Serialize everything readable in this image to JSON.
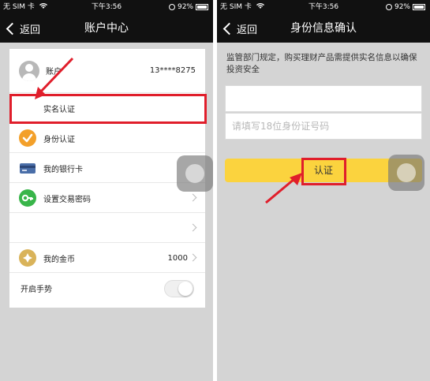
{
  "colors": {
    "accent_yellow": "#fbd33e",
    "highlight_red": "#e01e2b",
    "bar_dark": "#111111",
    "bg_gray": "#d4d4d4",
    "orange_icon": "#f3a02a",
    "green_icon": "#39b54a"
  },
  "left": {
    "status": {
      "carrier": "无 SIM 卡",
      "time": "下午3:56",
      "battery": "92%"
    },
    "nav": {
      "back_label": "返回",
      "title": "账户中心"
    },
    "account": {
      "label": "账户",
      "phone": "13****8275"
    },
    "items": [
      {
        "label": "实名认证",
        "icon": "id-card-icon"
      },
      {
        "label": "身份认证",
        "icon": "check-circle-icon"
      },
      {
        "label": "我的银行卡",
        "icon": "bank-card-icon"
      },
      {
        "label": "设置交易密码",
        "icon": "key-icon"
      },
      {
        "label": "",
        "icon": ""
      },
      {
        "label": "我的金币",
        "icon": "gold-coin-icon",
        "value": "1000"
      }
    ],
    "gesture": {
      "label": "开启手势"
    }
  },
  "right": {
    "status": {
      "carrier": "无 SIM 卡",
      "time": "下午3:56",
      "battery": "92%"
    },
    "nav": {
      "back_label": "返回",
      "title": "身份信息确认"
    },
    "notice": "监管部门规定，购买理财产品需提供实名信息以确保投资安全",
    "name_field": {
      "value": "",
      "placeholder": ""
    },
    "id_field": {
      "value": "",
      "placeholder": "请填写18位身份证号码"
    },
    "submit_label": "认证"
  }
}
